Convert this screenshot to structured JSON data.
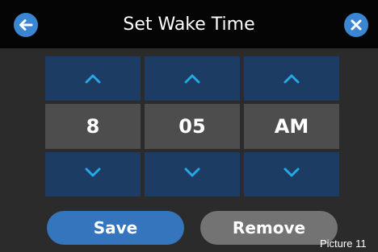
{
  "header": {
    "title": "Set Wake Time",
    "back_icon": "arrow-left-icon",
    "close_icon": "close-icon"
  },
  "time": {
    "columns": [
      {
        "name": "hour",
        "value": "8",
        "up_icon": "chevron-up-icon",
        "down_icon": "chevron-down-icon"
      },
      {
        "name": "minute",
        "value": "05",
        "up_icon": "chevron-up-icon",
        "down_icon": "chevron-down-icon"
      },
      {
        "name": "period",
        "value": "AM",
        "up_icon": "chevron-up-icon",
        "down_icon": "chevron-down-icon"
      }
    ]
  },
  "actions": {
    "save_label": "Save",
    "remove_label": "Remove"
  },
  "caption": "Picture 11",
  "colors": {
    "accent": "#3b86d2",
    "arrow": "#27a8e6",
    "arrow_cell": "#1c3c64",
    "value_cell": "#4d4d4d",
    "save": "#3575bd",
    "remove": "#737373"
  }
}
